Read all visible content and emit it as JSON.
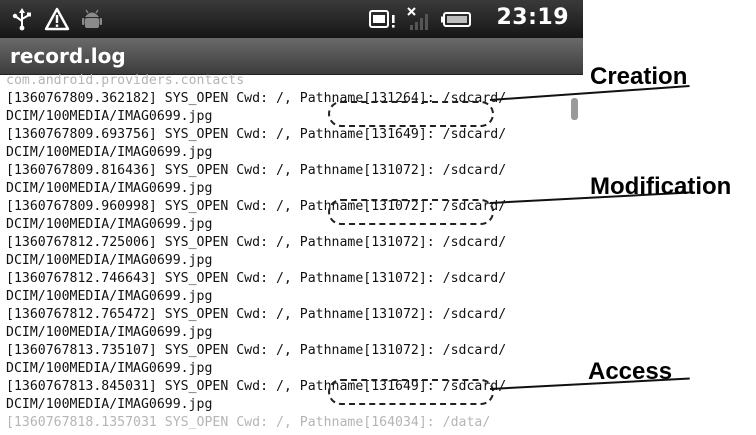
{
  "statusbar": {
    "time": "23:19",
    "left_icons": [
      "usb-icon",
      "warning-icon",
      "android-debug-icon"
    ],
    "right_icons": [
      "sd-card-alert-icon",
      "no-signal-icon",
      "battery-icon"
    ]
  },
  "app": {
    "title": "record.log"
  },
  "log": {
    "lines": [
      {
        "text": "com.android.providers.contacts",
        "faded": true
      },
      {
        "text": "[1360767809.362182] SYS_OPEN Cwd: /, Pathname[131264]: /sdcard/",
        "faded": false
      },
      {
        "text": "DCIM/100MEDIA/IMAG0699.jpg",
        "faded": false
      },
      {
        "text": "[1360767809.693756] SYS_OPEN Cwd: /, Pathname[131649]: /sdcard/",
        "faded": false
      },
      {
        "text": "DCIM/100MEDIA/IMAG0699.jpg",
        "faded": false
      },
      {
        "text": "[1360767809.816436] SYS_OPEN Cwd: /, Pathname[131072]: /sdcard/",
        "faded": false
      },
      {
        "text": "DCIM/100MEDIA/IMAG0699.jpg",
        "faded": false
      },
      {
        "text": "[1360767809.960998] SYS_OPEN Cwd: /, Pathname[131072]: /sdcard/",
        "faded": false
      },
      {
        "text": "DCIM/100MEDIA/IMAG0699.jpg",
        "faded": false
      },
      {
        "text": "[1360767812.725006] SYS_OPEN Cwd: /, Pathname[131072]: /sdcard/",
        "faded": false
      },
      {
        "text": "DCIM/100MEDIA/IMAG0699.jpg",
        "faded": false
      },
      {
        "text": "[1360767812.746643] SYS_OPEN Cwd: /, Pathname[131072]: /sdcard/",
        "faded": false
      },
      {
        "text": "DCIM/100MEDIA/IMAG0699.jpg",
        "faded": false
      },
      {
        "text": "[1360767812.765472] SYS_OPEN Cwd: /, Pathname[131072]: /sdcard/",
        "faded": false
      },
      {
        "text": "DCIM/100MEDIA/IMAG0699.jpg",
        "faded": false
      },
      {
        "text": "[1360767813.735107] SYS_OPEN Cwd: /, Pathname[131072]: /sdcard/",
        "faded": false
      },
      {
        "text": "DCIM/100MEDIA/IMAG0699.jpg",
        "faded": false
      },
      {
        "text": "[1360767813.845031] SYS_OPEN Cwd: /, Pathname[131649]: /sdcard/",
        "faded": false
      },
      {
        "text": "DCIM/100MEDIA/IMAG0699.jpg",
        "faded": false
      },
      {
        "text": "[1360767818.1357031 SYS_OPEN Cwd: /, Pathname[164034]: /data/",
        "faded": true
      }
    ]
  },
  "annotations": {
    "creation": "Creation",
    "modification": "Modification",
    "access": "Access"
  },
  "colors": {
    "statusbar_bg": "#1e1e1e",
    "titlebar_bg": "#4e4e4e",
    "log_text": "#111111",
    "callout": "#000000"
  }
}
